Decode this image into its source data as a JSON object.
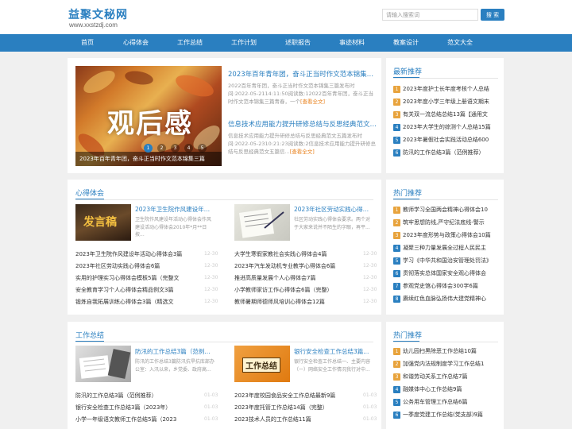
{
  "site": {
    "logo": "益聚文秘网",
    "url": "www.xxstzdj.com"
  },
  "search": {
    "placeholder": "请输入搜索词",
    "button": "搜 索"
  },
  "nav": [
    "首页",
    "心得体会",
    "工作总结",
    "工作计划",
    "述职报告",
    "事迹材料",
    "教案设计",
    "范文大全"
  ],
  "slider": {
    "overlay_text": "观后感",
    "caption": "2023年百年青年团，奋斗正当时作文范本锦集三篇",
    "dots": [
      "1",
      "2",
      "3",
      "4",
      "5"
    ]
  },
  "featured": [
    {
      "title": "2023年百年青年团，奋斗正当时作文范本锦集三篇",
      "desc": "2022百年青年团，奋斗正当时作文范本锦集三篇发布时间:2022-05-2114:11:50阅读数:12022百年青年团，奋斗正当时作文范本锦集三篇青春，一个",
      "more": "[查看全文]"
    },
    {
      "title": "信息技术应用能力提升研修总结与反思经典范文五篇",
      "desc": "信息技术应用能力提升研修总结与反思经典范文五篇发布时间:2022-05-2310:21:23阅读数:2信息技术应用能力提升研修总结与反思经典范文五篇信...",
      "more": "[查看全文]"
    }
  ],
  "latest": {
    "title": "最新推荐",
    "items": [
      "2023年度护士长年度考核个人总结",
      "2023年度小学三年级上册语文期末",
      "有关双一流总结总结13篇【通用文",
      "2023年大学生的综测个人总结15篇",
      "2023年暑假社会实践活动总结600",
      "防汛的工作总结3篇（范例推荐）"
    ]
  },
  "xinde": {
    "title": "心得体会",
    "thumb1_text": "发言稿",
    "card1": {
      "title": "2023年卫生院作风建设年活动心得体...",
      "desc": "卫生院作风建设年活动心得体会作风建设活动心得体会2010年*月**日按..."
    },
    "card2": {
      "title": "2023年社区劳动实践心得体会6篇",
      "desc": "社区劳动实践心得体会要求。两个对于大家来说并不陌生的字眼，再平..."
    },
    "left_list": [
      {
        "t": "2023年卫生院作风建设年活动心得体会3篇",
        "d": "12-30"
      },
      {
        "t": "2023年社区劳动实践心得体会6篇",
        "d": "12-30"
      },
      {
        "t": "实用的护理实习心得体会模板5篇（完整文",
        "d": "12-30"
      },
      {
        "t": "安全教育学习个人心得体会精品例文3篇",
        "d": "12-30"
      },
      {
        "t": "锻炼自我拓展训练心得体会3篇（精选文",
        "d": "12-30"
      }
    ],
    "right_list": [
      {
        "t": "大学生寒假家教社会实践心得体会4篇",
        "d": "12-30"
      },
      {
        "t": "2023年汽车发动机专业教学心得体会6篇",
        "d": "12-30"
      },
      {
        "t": "推进高质量发展个人心得体会7篇",
        "d": "12-30"
      },
      {
        "t": "小学教师家访工作心得体会6篇（完整）",
        "d": "12-30"
      },
      {
        "t": "教师暑期师德师风培训心得体会12篇",
        "d": "12-30"
      }
    ]
  },
  "hot1": {
    "title": "热门推荐",
    "items": [
      "教师学习全国两会精神心得体会10",
      "筑牢思想防线,严守纪法底线-警示",
      "2023年度形势与政策心得体会10篇",
      "凝聚三种力量发展全过程人民民主",
      "学习《中华共和国治安管理处罚法》",
      "贯彻落实总体国家安全观心得体会",
      "参观党史馆心得体会300字6篇",
      "赓续红色血脉弘扬伟大建党精神心"
    ]
  },
  "gongzuo": {
    "title": "工作总结",
    "thumb2_text": "工作总结",
    "card1": {
      "title": "防汛的工作总结3篇（范例推...",
      "desc": "防汛的工作总结3篇防汛抗旱抗库部办公室：入汛以来，乡党委、政府高..."
    },
    "card2": {
      "title": "银行安全检查工作总结3篇...",
      "desc": "银行安全检查工作总结一、主要内容（一）网络安全工作情况我行对中..."
    },
    "left_list": [
      {
        "t": "防汛的工作总结3篇（范例推荐）",
        "d": "01-03"
      },
      {
        "t": "银行安全检查工作总结3篇（2023年）",
        "d": "01-03"
      },
      {
        "t": "小学一年级语文教师工作总结5篇（2023",
        "d": "01-03"
      }
    ],
    "right_list": [
      {
        "t": "2023年度校园食品安全工作总结最新9篇",
        "d": "01-03"
      },
      {
        "t": "2023年度托管工作总结14篇（完整）",
        "d": "01-03"
      },
      {
        "t": "2023技术人员的工作总结11篇",
        "d": "01-03"
      }
    ]
  },
  "hot2": {
    "title": "热门推荐",
    "items": [
      "幼儿园扫黑除恶工作总结10篇",
      "加强党内法规制度学习工作总结1",
      "和谐劳动关系工作总结7篇",
      "融媒体中心工作总结9篇",
      "公务用车管理工作总结6篇",
      "一季度党建工作总结(党支部)9篇"
    ]
  }
}
